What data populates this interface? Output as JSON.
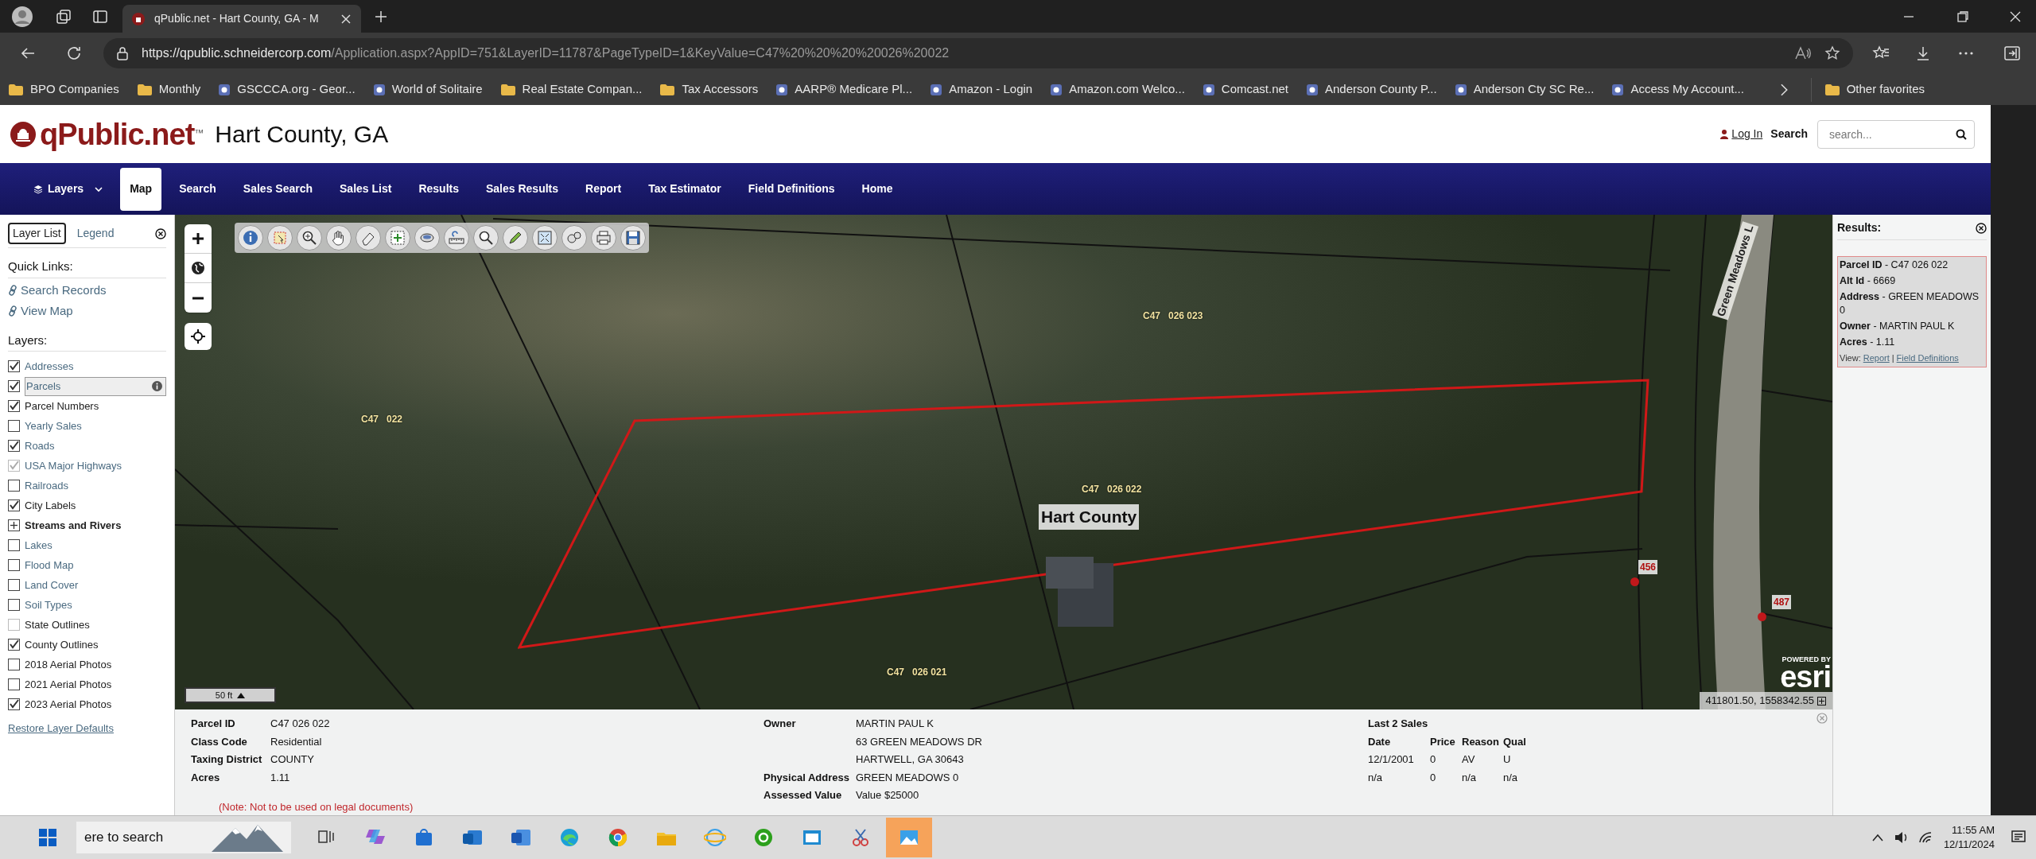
{
  "browser": {
    "tab_title": "qPublic.net - Hart County, GA - M",
    "url_host": "https://qpublic.schneidercorp.com",
    "url_path": "/Application.aspx?AppID=751&LayerID=11787&PageTypeID=1&KeyValue=C47%20%20%20%20026%20022",
    "bookmarks": [
      {
        "label": "BPO Companies",
        "kind": "folder"
      },
      {
        "label": "Monthly",
        "kind": "folder"
      },
      {
        "label": "GSCCCA.org - Geor...",
        "kind": "site"
      },
      {
        "label": "World of Solitaire",
        "kind": "site"
      },
      {
        "label": "Real Estate Compan...",
        "kind": "folder"
      },
      {
        "label": "Tax Accessors",
        "kind": "folder"
      },
      {
        "label": "AARP® Medicare Pl...",
        "kind": "site"
      },
      {
        "label": "Amazon - Login",
        "kind": "site"
      },
      {
        "label": "Amazon.com Welco...",
        "kind": "site"
      },
      {
        "label": "Comcast.net",
        "kind": "site"
      },
      {
        "label": "Anderson County P...",
        "kind": "site"
      },
      {
        "label": "Anderson Cty SC Re...",
        "kind": "site"
      },
      {
        "label": "Access My Account...",
        "kind": "site"
      }
    ],
    "other_favorites": "Other favorites"
  },
  "site": {
    "logo": "qPublic.net",
    "logo_mark": "™",
    "county": "Hart County, GA",
    "login": "Log In",
    "search_label": "Search",
    "search_placeholder": "search..."
  },
  "nav": [
    {
      "label": "Layers",
      "kind": "dropdown",
      "selected": false
    },
    {
      "label": "Map",
      "kind": "link",
      "selected": true
    },
    {
      "label": "Search",
      "kind": "link",
      "selected": false
    },
    {
      "label": "Sales Search",
      "kind": "link",
      "selected": false
    },
    {
      "label": "Sales List",
      "kind": "link",
      "selected": false
    },
    {
      "label": "Results",
      "kind": "link",
      "selected": false
    },
    {
      "label": "Sales Results",
      "kind": "link",
      "selected": false
    },
    {
      "label": "Report",
      "kind": "link",
      "selected": false
    },
    {
      "label": "Tax Estimator",
      "kind": "link",
      "selected": false
    },
    {
      "label": "Field Definitions",
      "kind": "link",
      "selected": false
    },
    {
      "label": "Home",
      "kind": "link",
      "selected": false
    }
  ],
  "left_panel": {
    "tabs": [
      {
        "label": "Layer List",
        "selected": true
      },
      {
        "label": "Legend",
        "selected": false
      }
    ],
    "quick_links_title": "Quick Links:",
    "quick_links": [
      "Search Records",
      "View Map"
    ],
    "layers_title": "Layers:",
    "layers": [
      {
        "label": "Addresses",
        "kind": "checkbox",
        "checked": true,
        "link": true,
        "disabled": false,
        "selected": false
      },
      {
        "label": "Parcels",
        "kind": "checkbox",
        "checked": true,
        "link": true,
        "disabled": false,
        "selected": true
      },
      {
        "label": "Parcel Numbers",
        "kind": "checkbox",
        "checked": true,
        "link": false,
        "disabled": false,
        "selected": false
      },
      {
        "label": "Yearly Sales",
        "kind": "checkbox",
        "checked": false,
        "link": true,
        "disabled": false,
        "selected": false
      },
      {
        "label": "Roads",
        "kind": "checkbox",
        "checked": true,
        "link": true,
        "disabled": false,
        "selected": false
      },
      {
        "label": "USA Major Highways",
        "kind": "checkbox",
        "checked": true,
        "link": true,
        "disabled": true,
        "selected": false
      },
      {
        "label": "Railroads",
        "kind": "checkbox",
        "checked": false,
        "link": true,
        "disabled": false,
        "selected": false
      },
      {
        "label": "City Labels",
        "kind": "checkbox",
        "checked": true,
        "link": false,
        "disabled": false,
        "selected": false
      },
      {
        "label": "Streams and Rivers",
        "kind": "group",
        "expanded": false,
        "link": false,
        "selected": false
      },
      {
        "label": "Lakes",
        "kind": "checkbox",
        "checked": false,
        "link": true,
        "disabled": false,
        "selected": false
      },
      {
        "label": "Flood Map",
        "kind": "checkbox",
        "checked": false,
        "link": true,
        "disabled": false,
        "selected": false
      },
      {
        "label": "Land Cover",
        "kind": "checkbox",
        "checked": false,
        "link": true,
        "disabled": false,
        "selected": false
      },
      {
        "label": "Soil Types",
        "kind": "checkbox",
        "checked": false,
        "link": true,
        "disabled": false,
        "selected": false
      },
      {
        "label": "State Outlines",
        "kind": "checkbox",
        "checked": false,
        "link": false,
        "disabled": true,
        "selected": false
      },
      {
        "label": "County Outlines",
        "kind": "checkbox",
        "checked": true,
        "link": false,
        "disabled": false,
        "selected": false
      },
      {
        "label": "2018 Aerial Photos",
        "kind": "checkbox",
        "checked": false,
        "link": false,
        "disabled": false,
        "selected": false
      },
      {
        "label": "2021 Aerial Photos",
        "kind": "checkbox",
        "checked": false,
        "link": false,
        "disabled": false,
        "selected": false
      },
      {
        "label": "2023 Aerial Photos",
        "kind": "checkbox",
        "checked": true,
        "link": false,
        "disabled": false,
        "selected": false
      }
    ],
    "restore": "Restore Layer Defaults"
  },
  "map": {
    "parcel_labels": [
      "C47   026 023",
      "C47   022",
      "C47   026 022",
      "C47   026 021"
    ],
    "city_label": "Hart County",
    "road_label": "Green Meadows L",
    "address_points": [
      "456",
      "487"
    ],
    "scale": "50 ft",
    "esri_powered": "POWERED BY",
    "esri": "esri",
    "coordinates": "411801.50, 1558342.55"
  },
  "parcel_info": {
    "fields": [
      {
        "label": "Parcel ID",
        "value": "C47 026 022"
      },
      {
        "label": "Class Code",
        "value": "Residential"
      },
      {
        "label": "Taxing District",
        "value": "COUNTY"
      },
      {
        "label": "Acres",
        "value": "1.11"
      }
    ],
    "note": "(Note: Not to be used on legal documents)",
    "owner_label": "Owner",
    "owner_lines": [
      "MARTIN PAUL K",
      "63 GREEN MEADOWS DR",
      "HARTWELL, GA 30643"
    ],
    "physical_address_label": "Physical Address",
    "physical_address": "GREEN MEADOWS 0",
    "assessed_label": "Assessed Value",
    "assessed": "Value $25000",
    "sales_title": "Last 2 Sales",
    "sales_columns": [
      "Date",
      "Price",
      "Reason",
      "Qual"
    ],
    "sales_rows": [
      [
        "12/1/2001",
        "0",
        "AV",
        "U"
      ],
      [
        "n/a",
        "0",
        "n/a",
        "n/a"
      ]
    ]
  },
  "results": {
    "title": "Results:",
    "lines": [
      "**Parcel ID** - C47 026 022",
      "**Alt Id** - 6669",
      "**Address** - GREEN MEADOWS 0",
      "**Owner** - MARTIN PAUL K",
      "**Acres** - 1.11"
    ],
    "view_label": "View:",
    "links": [
      "Report",
      "Field Definitions"
    ],
    "separator": "|"
  },
  "taskbar": {
    "search": "ere to search",
    "time": "11:55 AM",
    "date": "12/11/2024"
  }
}
